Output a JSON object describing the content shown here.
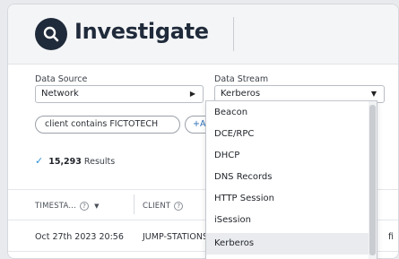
{
  "app": {
    "title": "Investigate"
  },
  "filters": {
    "data_source_label": "Data Source",
    "data_source_value": "Network",
    "data_stream_label": "Data Stream",
    "data_stream_value": "Kerberos"
  },
  "chips": [
    {
      "label": "client contains FICTOTECH"
    },
    {
      "label": "+Add"
    }
  ],
  "results": {
    "count": "15,293",
    "label": "Results"
  },
  "table": {
    "headers": [
      "TIMESTA...",
      "CLIENT"
    ],
    "rows": [
      {
        "timestamp": "Oct 27th 2023 20:56",
        "client": "JUMP-STATIONS",
        "trailing": "fi"
      }
    ]
  },
  "dropdown": {
    "options": [
      "Beacon",
      "DCE/RPC",
      "DHCP",
      "DNS Records",
      "HTTP Session",
      "iSession",
      "Kerberos"
    ],
    "selected": "Kerberos"
  },
  "colors": {
    "accent": "#2d8fd5",
    "logo_bg": "#1f2a3a"
  }
}
